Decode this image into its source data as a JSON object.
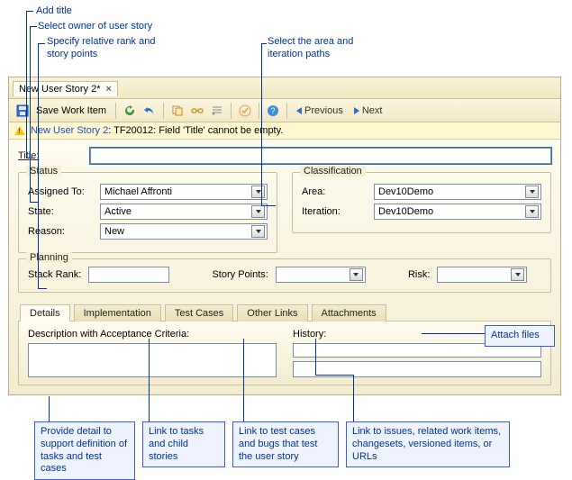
{
  "callouts": {
    "add_title": "Add title",
    "select_owner": "Select owner of user story",
    "rank_points": "Specify relative rank and\nstory points",
    "area_iter": "Select the area and\niteration paths",
    "attach_files": "Attach files",
    "bottom1": "Provide detail to\nsupport definition\nof tasks and test\ncases",
    "bottom2": "Link to tasks\nand child\nstories",
    "bottom3": "Link to test cases\nand bugs that test\nthe user story",
    "bottom4": "Link to issues, related work\nitems, changesets, versioned\nitems, or URLs"
  },
  "tab": {
    "title": "New User Story 2*"
  },
  "toolbar": {
    "save_label": "Save Work Item",
    "prev": "Previous",
    "next": "Next"
  },
  "error": {
    "prefix": "New User Story 2",
    "msg": ": TF20012: Field 'Title' cannot be empty."
  },
  "fields": {
    "title_label": "Title:",
    "title_value": ""
  },
  "status": {
    "legend": "Status",
    "assigned_to": {
      "label": "Assigned To:",
      "value": "Michael Affronti"
    },
    "state": {
      "label": "State:",
      "value": "Active"
    },
    "reason": {
      "label": "Reason:",
      "value": "New"
    }
  },
  "classification": {
    "legend": "Classification",
    "area": {
      "label": "Area:",
      "value": "Dev10Demo"
    },
    "iteration": {
      "label": "Iteration:",
      "value": "Dev10Demo"
    }
  },
  "planning": {
    "legend": "Planning",
    "stack_rank": {
      "label": "Stack Rank:",
      "value": ""
    },
    "story_points": {
      "label": "Story Points:",
      "value": ""
    },
    "risk": {
      "label": "Risk:",
      "value": ""
    }
  },
  "tabs": {
    "details": "Details",
    "implementation": "Implementation",
    "test_cases": "Test Cases",
    "other_links": "Other Links",
    "attachments": "Attachments"
  },
  "panel": {
    "description_label": "Description with Acceptance Criteria:",
    "history_label": "History:"
  }
}
